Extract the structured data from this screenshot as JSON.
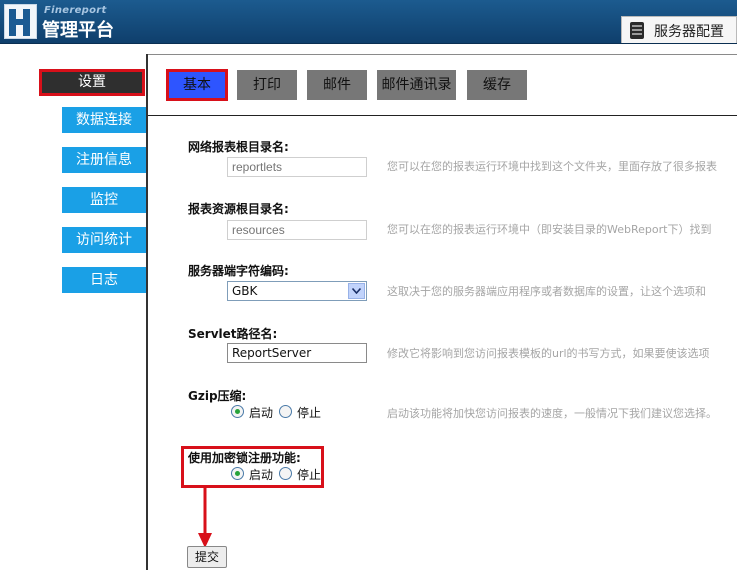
{
  "header": {
    "brand_sub": "Finereport",
    "brand_main": "管理平台",
    "server_tab": {
      "label": "服务器配置",
      "icon": "server-icon"
    }
  },
  "sidebar": {
    "items": [
      {
        "label": "设置",
        "active": true
      },
      {
        "label": "数据连接"
      },
      {
        "label": "注册信息"
      },
      {
        "label": "监控"
      },
      {
        "label": "访问统计"
      },
      {
        "label": "日志"
      }
    ]
  },
  "tabs": [
    {
      "label": "基本",
      "active": true
    },
    {
      "label": "打印"
    },
    {
      "label": "邮件"
    },
    {
      "label": "邮件通讯录"
    },
    {
      "label": "缓存"
    }
  ],
  "form": {
    "report_root": {
      "label": "网络报表根目录名:",
      "placeholder": "reportlets",
      "help": "您可以在您的报表运行环境中找到这个文件夹，里面存放了很多报表"
    },
    "resource_root": {
      "label": "报表资源根目录名:",
      "placeholder": "resources",
      "help": "您可以在您的报表运行环境中（即安装目录的WebReport下）找到"
    },
    "encoding": {
      "label": "服务器端字符编码:",
      "value": "GBK",
      "help": "这取决于您的服务器端应用程序或者数据库的设置，让这个选项和"
    },
    "servlet": {
      "label": "Servlet路径名:",
      "value": "ReportServer",
      "help": "修改它将影响到您访问报表模板的url的书写方式，如果要使该选项"
    },
    "gzip": {
      "label": "Gzip压缩:",
      "on_label": "启动",
      "off_label": "停止",
      "selected": "on",
      "help": "启动该功能将加快您访问报表的速度，一般情况下我们建议您选择。"
    },
    "lock": {
      "label": "使用加密锁注册功能:",
      "on_label": "启动",
      "off_label": "停止",
      "selected": "on"
    },
    "submit_label": "提交"
  },
  "colors": {
    "header": "#145083",
    "sidebar_item": "#1aa0e6",
    "tab_active": "#2e55ff",
    "tab": "#777777",
    "highlight": "#d8101a"
  }
}
